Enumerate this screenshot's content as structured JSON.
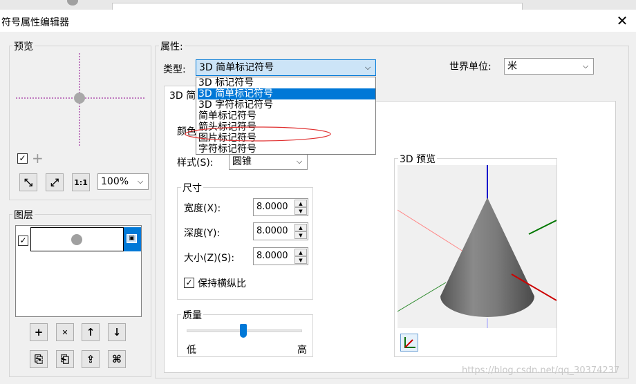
{
  "window": {
    "title": "符号属性编辑器",
    "close_glyph": "✕"
  },
  "preview": {
    "label": "预览",
    "visible_checked": true,
    "add_glyph": "+",
    "zoom_value": "100%",
    "buttons": {
      "fit": "⤡",
      "expand": "⤢",
      "actual": "1:1"
    }
  },
  "layers": {
    "label": "图层",
    "items": [
      {
        "checked": true
      }
    ],
    "buttons": {
      "add": "+",
      "remove": "✕",
      "up": "↑",
      "down": "↓",
      "copy": "⎘",
      "paste": "⎗",
      "import": "⇪",
      "tag": "⌘"
    }
  },
  "properties": {
    "label": "属性:",
    "type_label": "类型:",
    "type_value": "3D 简单标记符号",
    "world_unit_label": "世界单位:",
    "world_unit_value": "米",
    "type_options": [
      {
        "label": "3D 标记符号",
        "selected": false
      },
      {
        "label": "3D 简单标记符号",
        "selected": true
      },
      {
        "label": "3D 字符标记符号",
        "selected": false
      },
      {
        "label": "简单标记符号",
        "selected": false
      },
      {
        "label": "箭头标记符号",
        "selected": false
      },
      {
        "label": "图片标记符号",
        "selected": false
      },
      {
        "label": "字符标记符号",
        "selected": false
      }
    ]
  },
  "tab": {
    "label": "3D 简单标记符号",
    "color_label": "颜色",
    "style_label": "样式(S):",
    "style_value": "圆锥",
    "size_group": {
      "label": "尺寸",
      "width_label": "宽度(X):",
      "width_value": "8.0000",
      "depth_label": "深度(Y):",
      "depth_value": "8.0000",
      "size_label": "大小(Z)(S):",
      "size_value": "8.0000",
      "keep_ratio_label": "保持横纵比",
      "keep_ratio_checked": true
    },
    "quality_group": {
      "label": "质量",
      "low_label": "低",
      "high_label": "高",
      "value": 0.49
    },
    "preview3d": {
      "label": "3D 预览",
      "cone_color": "#737373",
      "axis_colors": {
        "z": "#0000cc",
        "x": "#cc0000",
        "y": "#007700"
      }
    }
  },
  "watermark": "https://blog.csdn.net/qq_30374237"
}
